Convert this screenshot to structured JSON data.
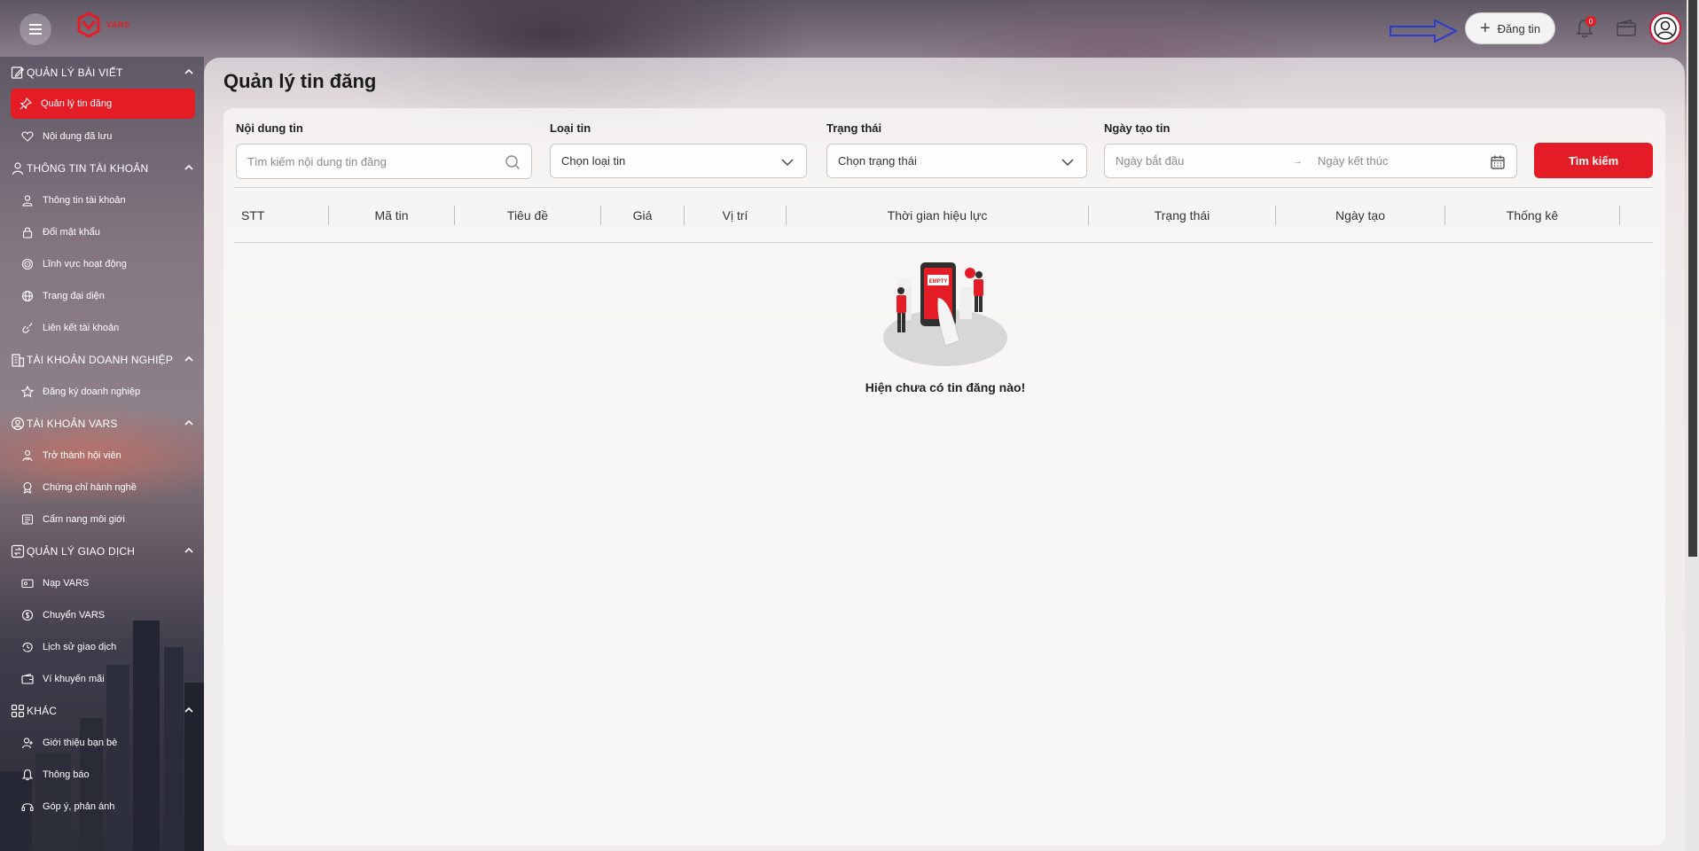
{
  "header": {
    "logo_text": "VARS",
    "post_button_label": "Đăng tin",
    "notification_count": "0"
  },
  "sidebar": {
    "sections": [
      {
        "title": "QUẢN LÝ BÀI VIẾT",
        "items": [
          "Quản lý tin đăng",
          "Nội dung đã lưu"
        ]
      },
      {
        "title": "THÔNG TIN TÀI KHOẢN",
        "items": [
          "Thông tin tài khoản",
          "Đổi mật khẩu",
          "Lĩnh vực hoạt động",
          "Trang đại diện",
          "Liên kết tài khoản"
        ]
      },
      {
        "title": "TÀI KHOẢN DOANH NGHIỆP",
        "items": [
          "Đăng ký doanh nghiệp"
        ]
      },
      {
        "title": "TÀI KHOẢN VARS",
        "items": [
          "Trở thành hội viên",
          "Chứng chỉ hành nghề",
          "Cẩm nang môi giới"
        ]
      },
      {
        "title": "QUẢN LÝ GIAO DỊCH",
        "items": [
          "Nạp VARS",
          "Chuyển VARS",
          "Lịch sử giao dịch",
          "Ví khuyến mãi"
        ]
      },
      {
        "title": "KHÁC",
        "items": [
          "Giới thiệu bạn bè",
          "Thông báo",
          "Góp ý, phản ánh"
        ]
      }
    ]
  },
  "main": {
    "title": "Quản lý tin đăng",
    "filters": {
      "content_label": "Nội dung tin",
      "content_placeholder": "Tìm kiếm nội dung tin đăng",
      "type_label": "Loại tin",
      "type_value": "Chọn loại tin",
      "status_label": "Trạng thái",
      "status_value": "Chọn trạng thái",
      "date_label": "Ngày tạo tin",
      "date_start_placeholder": "Ngày bắt đầu",
      "date_separator": "→",
      "date_end_placeholder": "Ngày kết thúc",
      "search_button": "Tìm kiếm"
    },
    "table": {
      "columns": [
        "STT",
        "Mã tin",
        "Tiêu đề",
        "Giá",
        "Vị trí",
        "Thời gian hiệu lực",
        "Trạng thái",
        "Ngày tạo",
        "Thống kê"
      ],
      "rows": []
    },
    "empty": {
      "badge": "EMPTY",
      "message": "Hiện chưa có tin đăng nào!"
    }
  },
  "colors": {
    "accent": "#e31c25",
    "arrow": "#2a3bd1"
  }
}
